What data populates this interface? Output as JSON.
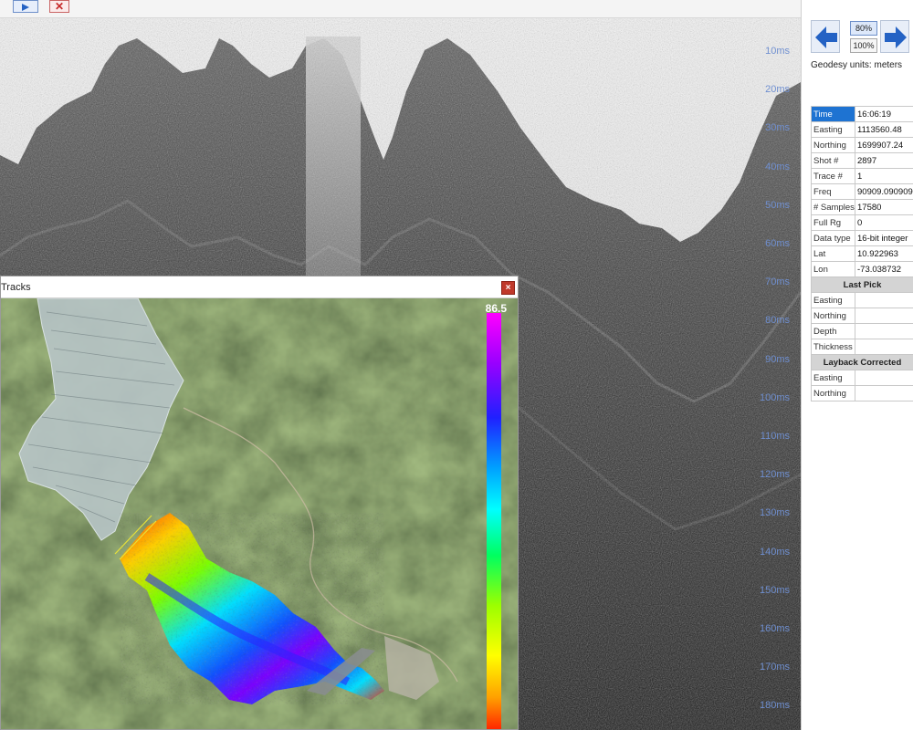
{
  "colors": {
    "depth_label": "#6f8fd0",
    "selected_row": "#1e73d2",
    "arrow_blue": "#2462c4",
    "close_red": "#c0392b"
  },
  "toolbar": {
    "nav_icon": "arrow-right-icon",
    "close_icon": "close-icon",
    "close_glyph": "✕"
  },
  "profile": {
    "depth_labels": [
      "10ms",
      "20ms",
      "30ms",
      "40ms",
      "50ms",
      "60ms",
      "70ms",
      "80ms",
      "90ms",
      "100ms",
      "110ms",
      "120ms",
      "130ms",
      "140ms",
      "150ms",
      "160ms",
      "170ms",
      "180ms"
    ]
  },
  "tracks_window": {
    "title": "Tracks",
    "close_glyph": "×",
    "scale_max": "86.5",
    "colorbar": [
      "#ff00ff",
      "#9900ff",
      "#2020ff",
      "#00a0ff",
      "#00ffff",
      "#00ff60",
      "#9cff00",
      "#ffff00",
      "#ffa000",
      "#ff2000"
    ]
  },
  "side_panel": {
    "back_icon": "arrow-left-icon",
    "forward_icon": "arrow-right-icon",
    "zoom_80": "80%",
    "zoom_100": "100%",
    "geodesy_units": "Geodesy units: meters",
    "info_rows": [
      {
        "key": "Time",
        "value": "16:06:19",
        "selected": true
      },
      {
        "key": "Easting",
        "value": "1113560.48"
      },
      {
        "key": "Northing",
        "value": "1699907.24"
      },
      {
        "key": "Shot #",
        "value": "2897"
      },
      {
        "key": "Trace #",
        "value": "1"
      },
      {
        "key": "Freq",
        "value": "90909.090909"
      },
      {
        "key": "# Samples",
        "value": "17580"
      },
      {
        "key": "Full Rg",
        "value": "0"
      },
      {
        "key": "Data type",
        "value": "16-bit integer"
      },
      {
        "key": "Lat",
        "value": "10.922963"
      },
      {
        "key": "Lon",
        "value": "-73.038732"
      }
    ],
    "last_pick_header": "Last Pick",
    "last_pick_rows": [
      {
        "key": "Easting",
        "value": ""
      },
      {
        "key": "Northing",
        "value": ""
      },
      {
        "key": "Depth",
        "value": ""
      },
      {
        "key": "Thickness",
        "value": ""
      }
    ],
    "layback_header": "Layback Corrected",
    "layback_rows": [
      {
        "key": "Easting",
        "value": ""
      },
      {
        "key": "Northing",
        "value": ""
      }
    ]
  }
}
